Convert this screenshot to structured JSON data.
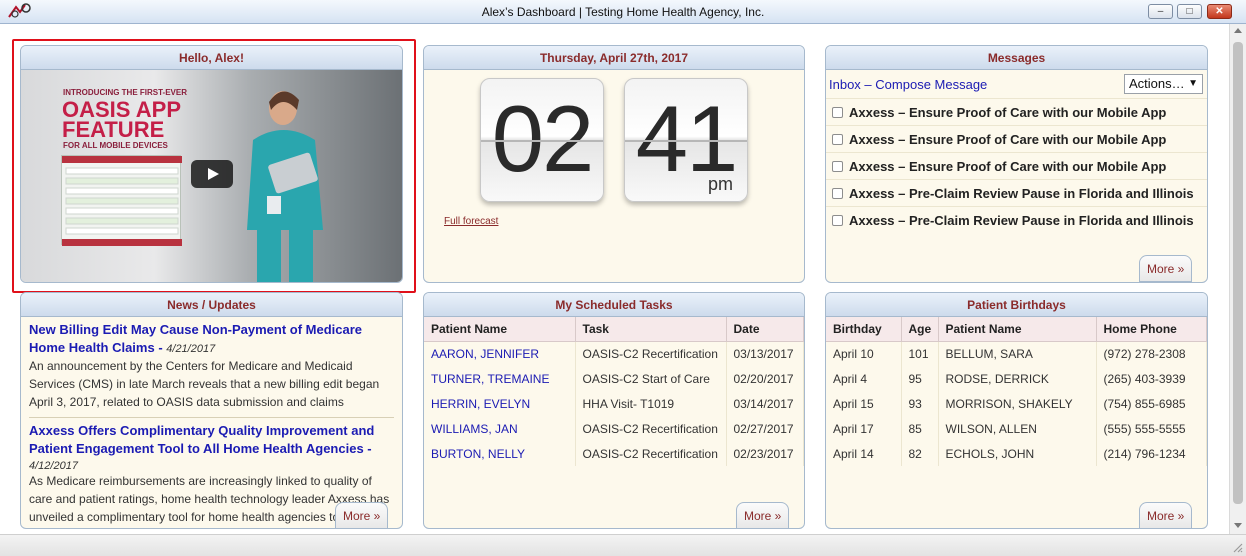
{
  "window": {
    "title": "Alex’s Dashboard | Testing Home Health Agency, Inc.",
    "min_label": "–",
    "max_label": "□",
    "close_label": "✕"
  },
  "welcome": {
    "title": "Hello, Alex!",
    "video": {
      "line1": "INTRODUCING THE FIRST-EVER",
      "line2": "OASIS APP FEATURE",
      "line3": "FOR ALL MOBILE DEVICES"
    }
  },
  "clock": {
    "title": "Thursday, April 27th, 2017",
    "hour": "02",
    "minute": "41",
    "ampm": "pm",
    "forecast_link": "Full forecast"
  },
  "messages": {
    "title": "Messages",
    "inbox_link": "Inbox",
    "separator": " – ",
    "compose_link": "Compose Message",
    "actions_label": "Actions…",
    "actions_arrow": "▼",
    "items": [
      "Axxess – Ensure Proof of Care with our Mobile App",
      "Axxess – Ensure Proof of Care with our Mobile App",
      "Axxess – Ensure Proof of Care with our Mobile App",
      "Axxess – Pre-Claim Review Pause in Florida and Illinois",
      "Axxess – Pre-Claim Review Pause in Florida and Illinois"
    ],
    "more_label": "More »"
  },
  "news": {
    "title": "News / Updates",
    "items": [
      {
        "headline": "New Billing Edit May Cause Non-Payment of Medicare Home Health Claims",
        "sep": " - ",
        "date": "4/21/2017",
        "body": "An announcement by the Centers for Medicare and Medicaid Services (CMS) in late March reveals that a new billing edit began April 3, 2017, related to OASIS data submission and claims"
      },
      {
        "headline": "Axxess Offers Complimentary Quality Improvement and Patient Engagement Tool to All Home Health Agencies",
        "sep": " - ",
        "date": "4/12/2017",
        "body": "As Medicare reimbursements are increasingly linked to quality of care and patient ratings, home health technology leader Axxess has unveiled a complimentary tool for home health agencies to"
      }
    ],
    "more_label": "More »"
  },
  "tasks": {
    "title": "My Scheduled Tasks",
    "headers": [
      "Patient Name",
      "Task",
      "Date"
    ],
    "rows": [
      [
        "AARON, JENNIFER",
        "OASIS-C2 Recertification",
        "03/13/2017"
      ],
      [
        "TURNER, TREMAINE",
        "OASIS-C2 Start of Care",
        "02/20/2017"
      ],
      [
        "HERRIN, EVELYN",
        "HHA Visit- T1019",
        "03/14/2017"
      ],
      [
        "WILLIAMS, JAN",
        "OASIS-C2 Recertification",
        "02/27/2017"
      ],
      [
        "BURTON, NELLY",
        "OASIS-C2 Recertification",
        "02/23/2017"
      ]
    ],
    "more_label": "More »"
  },
  "birthdays": {
    "title": "Patient Birthdays",
    "headers": [
      "Birthday",
      "Age",
      "Patient Name",
      "Home Phone"
    ],
    "rows": [
      [
        "April 10",
        "101",
        "BELLUM, SARA",
        "(972) 278-2308"
      ],
      [
        "April 4",
        "95",
        "RODSE, DERRICK",
        "(265) 403-3939"
      ],
      [
        "April 15",
        "93",
        "MORRISON, SHAKELY",
        "(754) 855-6985"
      ],
      [
        "April 17",
        "85",
        "WILSON, ALLEN",
        "(555) 555-5555"
      ],
      [
        "April 14",
        "82",
        "ECHOLS, JOHN",
        "(214) 796-1234"
      ]
    ],
    "more_label": "More »"
  },
  "colors": {
    "header_text": "#8a2b2b",
    "link": "#1b1bb3",
    "panel_bg": "#fdf9ec",
    "highlight": "#e0101a"
  }
}
